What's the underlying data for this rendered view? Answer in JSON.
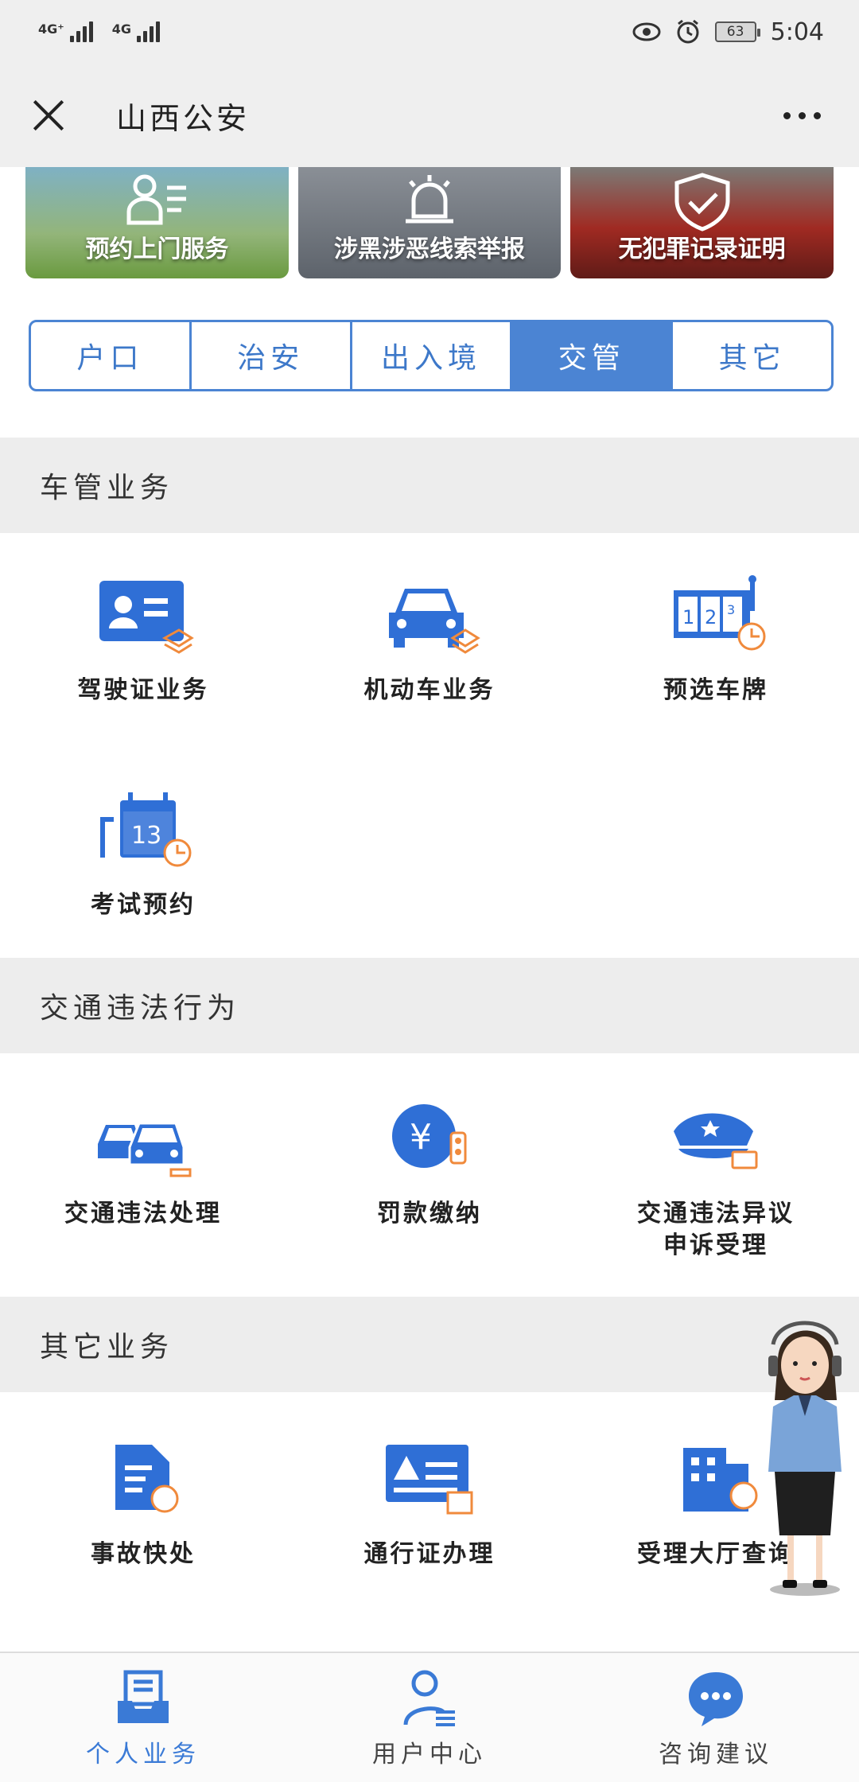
{
  "status_bar": {
    "signal1_label": "4G⁺",
    "signal2_label": "4G",
    "battery_level": "63",
    "time": "5:04"
  },
  "header": {
    "title": "山西公安"
  },
  "banners": [
    {
      "label": "预约上门服务",
      "icon": "person-list-icon"
    },
    {
      "label": "涉黑涉恶线索举报",
      "icon": "alarm-siren-icon"
    },
    {
      "label": "无犯罪记录证明",
      "icon": "shield-check-icon"
    }
  ],
  "tabs": [
    {
      "label": "户口",
      "active": false
    },
    {
      "label": "治安",
      "active": false
    },
    {
      "label": "出入境",
      "active": false
    },
    {
      "label": "交管",
      "active": true
    },
    {
      "label": "其它",
      "active": false
    }
  ],
  "sections": {
    "vehicle": {
      "title": "车管业务",
      "items": [
        {
          "label": "驾驶证业务",
          "icon": "id-card-icon"
        },
        {
          "label": "机动车业务",
          "icon": "car-icon"
        },
        {
          "label": "预选车牌",
          "icon": "license-plate-icon"
        },
        {
          "label": "考试预约",
          "icon": "calendar-icon",
          "day": "13"
        }
      ]
    },
    "violation": {
      "title": "交通违法行为",
      "items": [
        {
          "label": "交通违法处理",
          "icon": "cars-icon"
        },
        {
          "label": "罚款缴纳",
          "icon": "yen-coin-icon",
          "symbol": "¥"
        },
        {
          "label_line1": "交通违法异议",
          "label_line2": "申诉受理",
          "icon": "police-cap-icon"
        }
      ]
    },
    "other": {
      "title": "其它业务",
      "items": [
        {
          "label": "事故快处",
          "icon": "document-yen-icon"
        },
        {
          "label": "通行证办理",
          "icon": "warning-card-icon"
        },
        {
          "label": "受理大厅查询",
          "icon": "building-icon"
        }
      ]
    }
  },
  "bottom_nav": [
    {
      "label": "个人业务",
      "icon": "inbox-tray-icon",
      "active": true
    },
    {
      "label": "用户中心",
      "icon": "user-list-icon",
      "active": false
    },
    {
      "label": "咨询建议",
      "icon": "chat-bubble-icon",
      "active": false
    }
  ],
  "colors": {
    "accent": "#4b84d3",
    "icon_blue": "#2f6fd6",
    "icon_orange": "#f08a3c"
  }
}
